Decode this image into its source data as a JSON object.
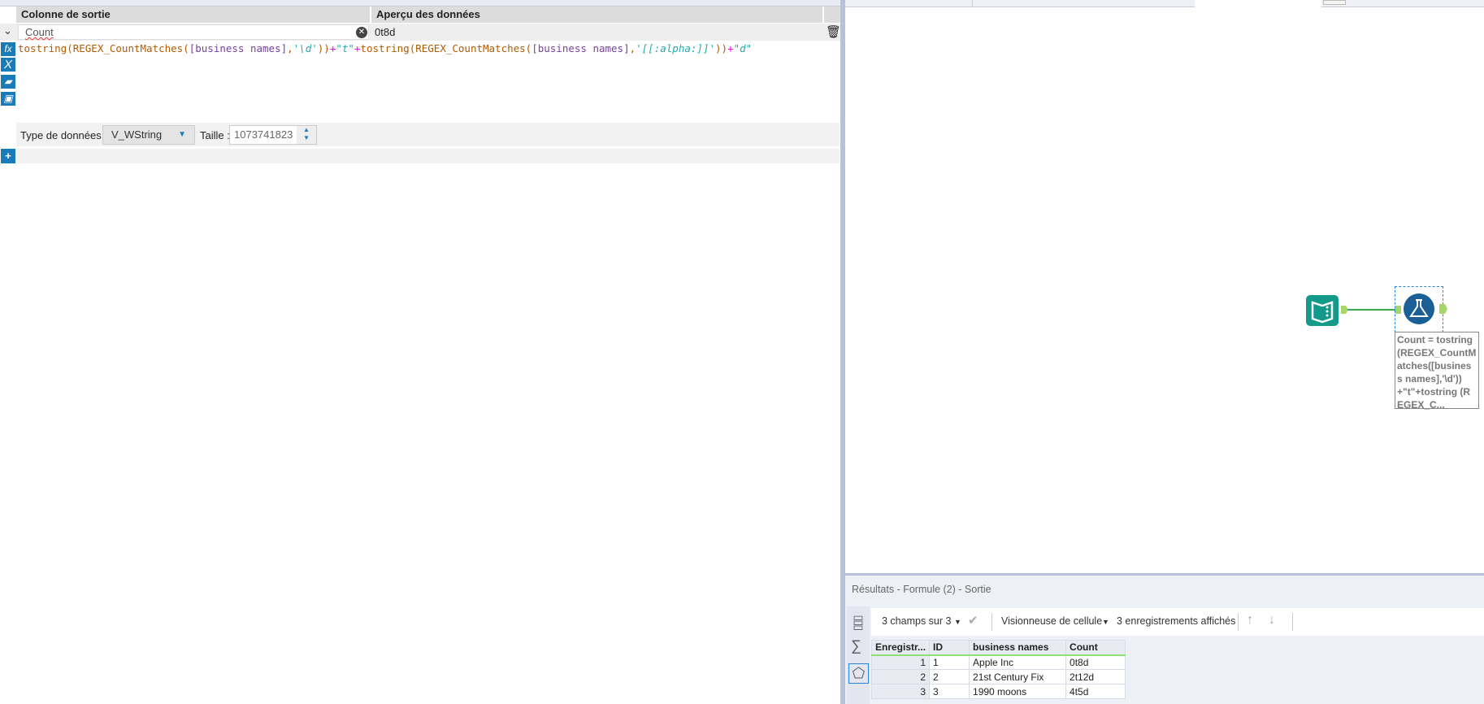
{
  "formula_panel": {
    "col_output_header": "Colonne de sortie",
    "col_preview_header": "Aperçu des données",
    "field_name": "Count",
    "preview_value": "0t8d",
    "expression_parts": [
      {
        "t": "tostring(REGEX_CountMatches(",
        "c": "f"
      },
      {
        "t": "[business names]",
        "c": "b"
      },
      {
        "t": ",",
        "c": "f"
      },
      {
        "t": "'\\d'",
        "c": "s"
      },
      {
        "t": "))",
        "c": "f"
      },
      {
        "t": "+",
        "c": "o"
      },
      {
        "t": "\"t\"",
        "c": "s"
      },
      {
        "t": "+",
        "c": "o"
      },
      {
        "t": "tostring(REGEX_CountMatches(",
        "c": "f"
      },
      {
        "t": "[business names]",
        "c": "b"
      },
      {
        "t": ",",
        "c": "f"
      },
      {
        "t": "'[[:alpha:]]'",
        "c": "s"
      },
      {
        "t": "))",
        "c": "f"
      },
      {
        "t": "+",
        "c": "o"
      },
      {
        "t": "\"d\"",
        "c": "s"
      }
    ],
    "data_type_label": "Type de données :",
    "data_type_value": "V_WString",
    "size_label": "Taille :",
    "size_value": "1073741823"
  },
  "canvas": {
    "annotation": "Count = tostring (REGEX_CountMatches([business names],'\\d')) +\"t\"+tostring (REGEX_C..."
  },
  "results": {
    "title": "Résultats - Formule (2) - Sortie",
    "fields_selector": "3 champs sur 3",
    "cell_viewer": "Visionneuse de cellule",
    "records_shown": "3 enregistrements affichés",
    "columns": [
      "Enregistr...",
      "ID",
      "business names",
      "Count"
    ],
    "rows": [
      [
        "1",
        "1",
        "Apple Inc",
        "0t8d"
      ],
      [
        "2",
        "2",
        "21st Century Fix",
        "2t12d"
      ],
      [
        "3",
        "3",
        "1990 moons",
        "4t5d"
      ]
    ]
  }
}
